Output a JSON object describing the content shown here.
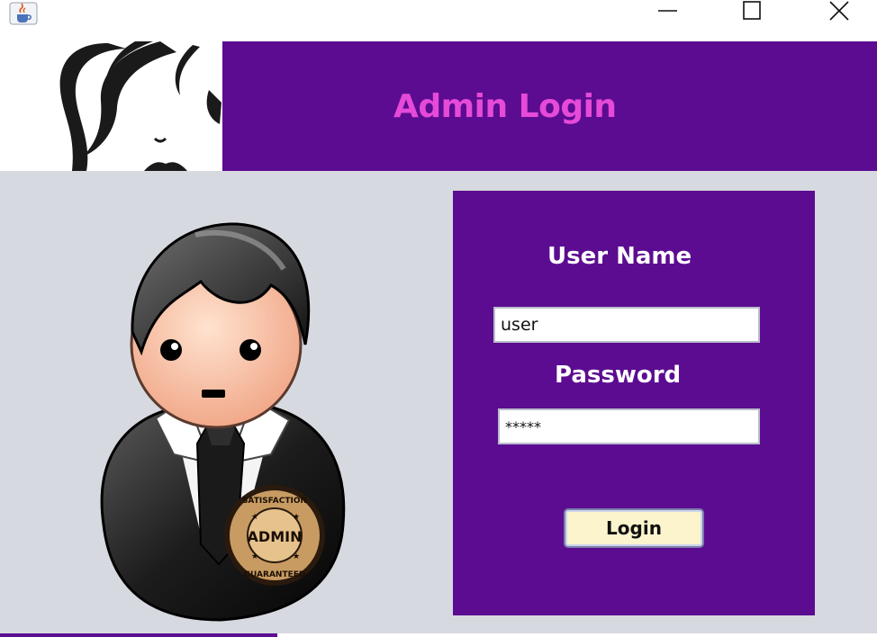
{
  "window": {
    "app_icon": "java-cup-icon",
    "controls": {
      "minimize_icon": "minimize-icon",
      "maximize_icon": "maximize-icon",
      "close_icon": "close-icon"
    }
  },
  "header": {
    "title": "Admin Login",
    "logo_icon": "woman-face-logo-icon"
  },
  "illustration": {
    "icon": "admin-avatar-icon",
    "badge_top_text": "SATISFACTION",
    "badge_center_text": "ADMIN",
    "badge_bottom_text": "GUARANTEED"
  },
  "login_form": {
    "username_label": "User Name",
    "username_value": "user",
    "password_label": "Password",
    "password_value": "*****",
    "login_button_label": "Login"
  },
  "colors": {
    "accent_purple": "#5c0c91",
    "title_pink": "#e64ad8",
    "panel_gray": "#d7d9e0",
    "button_cream": "#fbf4cd"
  }
}
